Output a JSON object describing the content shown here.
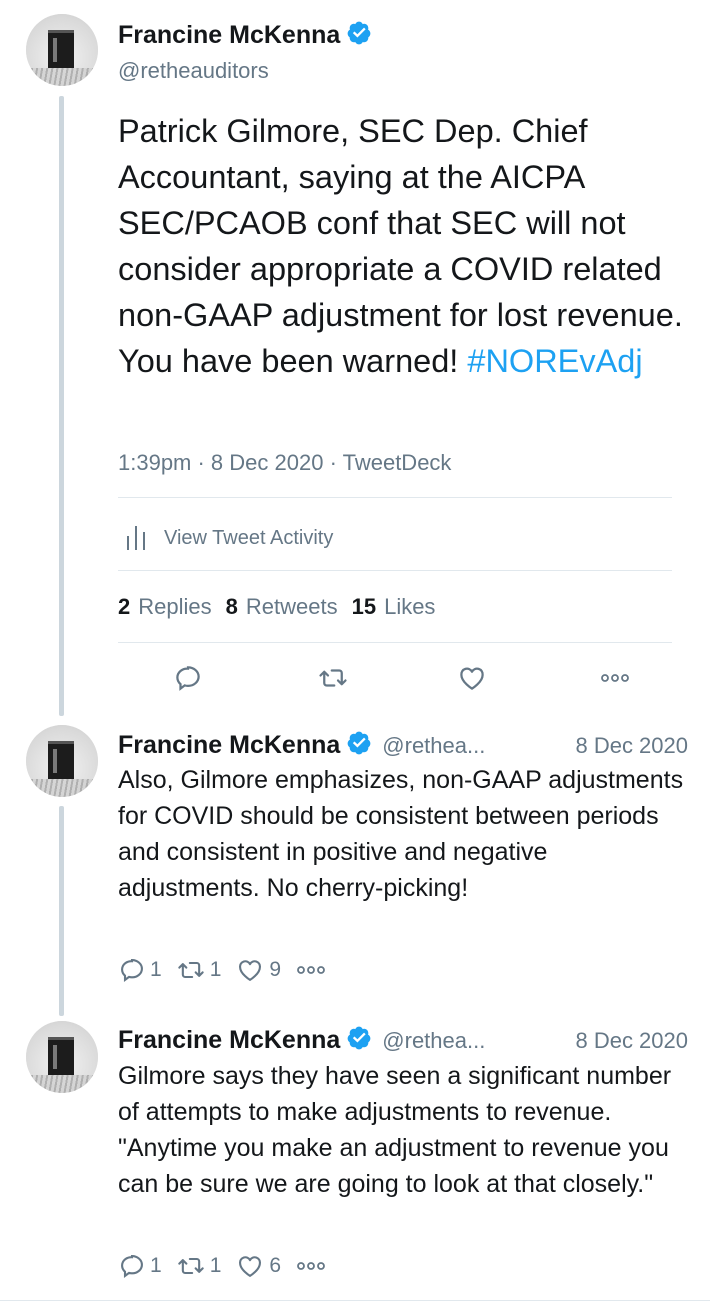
{
  "main_tweet": {
    "author": "Francine McKenna",
    "handle": "@retheauditors",
    "text": "Patrick Gilmore, SEC Dep. Chief Accountant, saying at the AICPA SEC/PCAOB conf that SEC will not consider appropriate a COVID related non-GAAP adjustment for lost revenue.  You have been warned!",
    "hashtag": "#NOREvAdj",
    "timestamp": "1:39pm · 8 Dec 2020 · TweetDeck",
    "activity_label": "View Tweet Activity",
    "replies_count": "2",
    "replies_label": "Replies",
    "retweets_count": "8",
    "retweets_label": "Retweets",
    "likes_count": "15",
    "likes_label": "Likes"
  },
  "replies": [
    {
      "author": "Francine McKenna",
      "handle": "@rethea...",
      "date": "8 Dec 2020",
      "text": "Also, Gilmore emphasizes, non-GAAP adjustments for COVID should be consistent between periods and consistent in positive and negative adjustments. No cherry-picking!",
      "reply_count": "1",
      "retweet_count": "1",
      "like_count": "9"
    },
    {
      "author": "Francine McKenna",
      "handle": "@rethea...",
      "date": "8 Dec 2020",
      "text": "Gilmore says they have seen a significant number of attempts to make adjustments to revenue.  \"Anytime you make an adjustment to revenue you can be sure we are going to look at that closely.\"",
      "reply_count": "1",
      "retweet_count": "1",
      "like_count": "6"
    }
  ],
  "colors": {
    "accent": "#1da1f2",
    "secondary_text": "#657786",
    "thread_line": "#ccd6dd"
  },
  "icons": [
    "verified-badge-icon",
    "bar-chart-icon",
    "reply-icon",
    "retweet-icon",
    "like-icon",
    "more-icon"
  ]
}
